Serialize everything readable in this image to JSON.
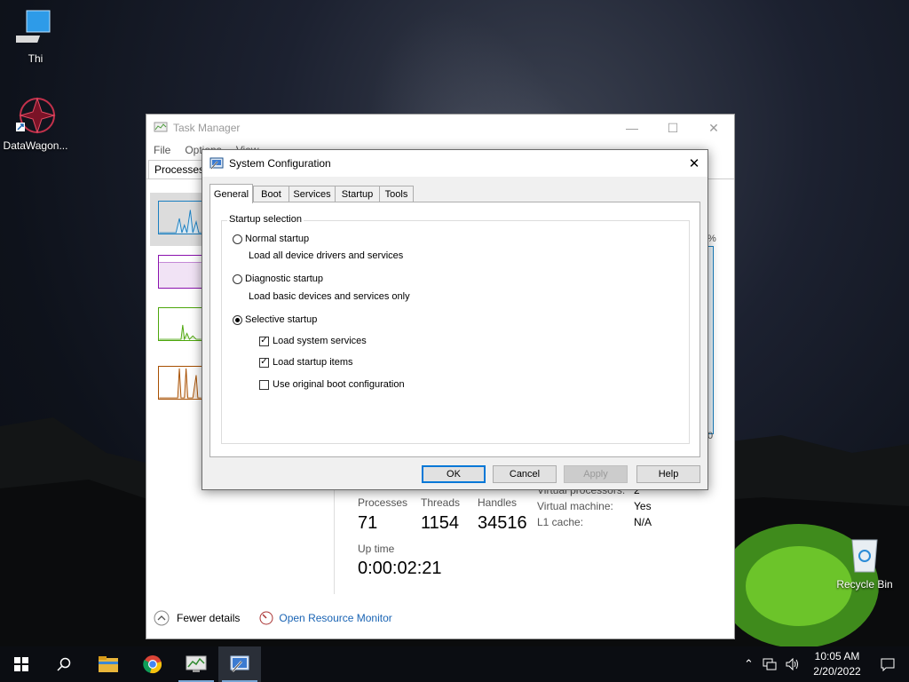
{
  "desktop": {
    "icons": [
      {
        "label": "Thi",
        "icon": "computer-icon"
      },
      {
        "label": "DataWagon...",
        "icon": "datawagon-shortcut-icon"
      },
      {
        "label": "Recycle Bin",
        "icon": "recycle-bin-icon"
      }
    ]
  },
  "task_manager": {
    "title": "Task Manager",
    "menu": [
      "File",
      "Options",
      "View"
    ],
    "tab_processes": "Processes",
    "axis_pct": "%",
    "axis_zero": "0",
    "stats": {
      "processes_label": "Processes",
      "processes_value": "71",
      "threads_label": "Threads",
      "threads_value": "1154",
      "handles_label": "Handles",
      "handles_value": "34516",
      "virtual_processors_label": "Virtual processors:",
      "virtual_processors_value": "2",
      "virtual_machine_label": "Virtual machine:",
      "virtual_machine_value": "Yes",
      "l1_cache_label": "L1 cache:",
      "l1_cache_value": "N/A",
      "uptime_label": "Up time",
      "uptime_value": "0:00:02:21"
    },
    "fewer_details": "Fewer details",
    "open_resource_monitor": "Open Resource Monitor"
  },
  "dialog": {
    "title": "System Configuration",
    "tabs": [
      "General",
      "Boot",
      "Services",
      "Startup",
      "Tools"
    ],
    "active_tab": "General",
    "group_title": "Startup selection",
    "normal_startup": "Normal startup",
    "normal_startup_desc": "Load all device drivers and services",
    "diagnostic_startup": "Diagnostic startup",
    "diagnostic_startup_desc": "Load basic devices and services only",
    "selective_startup": "Selective startup",
    "selected_option": "Selective startup",
    "load_system_services": "Load system services",
    "load_system_services_checked": true,
    "load_startup_items": "Load startup items",
    "load_startup_items_checked": true,
    "use_original_boot": "Use original boot configuration",
    "use_original_boot_checked": false,
    "buttons": {
      "ok": "OK",
      "cancel": "Cancel",
      "apply": "Apply",
      "help": "Help"
    }
  },
  "taskbar": {
    "time": "10:05 AM",
    "date": "2/20/2022",
    "items": [
      "start-icon",
      "search-icon",
      "file-explorer-icon",
      "chrome-icon",
      "task-manager-icon",
      "system-configuration-icon"
    ]
  },
  "colors": {
    "accent": "#0078d7",
    "link": "#1a64b4",
    "cpu_graph": "#1a7fc1",
    "memory_graph": "#8b12ae",
    "disk_graph": "#4da60c",
    "ethernet_graph": "#a74f01"
  }
}
